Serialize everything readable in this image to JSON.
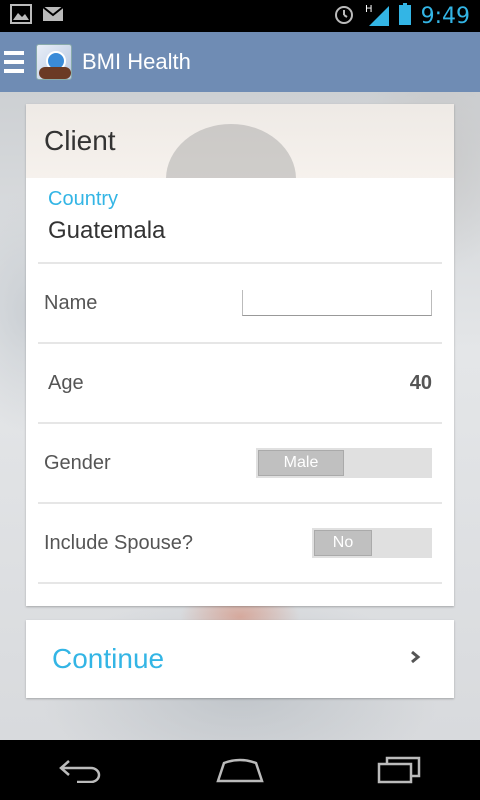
{
  "status_bar": {
    "time": "9:49",
    "network_label": "H"
  },
  "action_bar": {
    "title": "BMI Health"
  },
  "card": {
    "header_title": "Client",
    "country": {
      "label": "Country",
      "value": "Guatemala"
    },
    "name": {
      "label": "Name",
      "value": ""
    },
    "age": {
      "label": "Age",
      "value": "40"
    },
    "gender": {
      "label": "Gender",
      "value": "Male"
    },
    "spouse": {
      "label": "Include Spouse?",
      "value": "No"
    }
  },
  "continue_button": {
    "label": "Continue"
  },
  "colors": {
    "accent": "#33b5e5",
    "action_bar": "#6f8cb4"
  },
  "icons": [
    "image-icon",
    "mail-icon",
    "alarm-icon",
    "signal-icon",
    "battery-icon",
    "menu-icon",
    "app-logo",
    "chevron-right-icon",
    "back-icon",
    "home-icon",
    "recent-apps-icon"
  ]
}
